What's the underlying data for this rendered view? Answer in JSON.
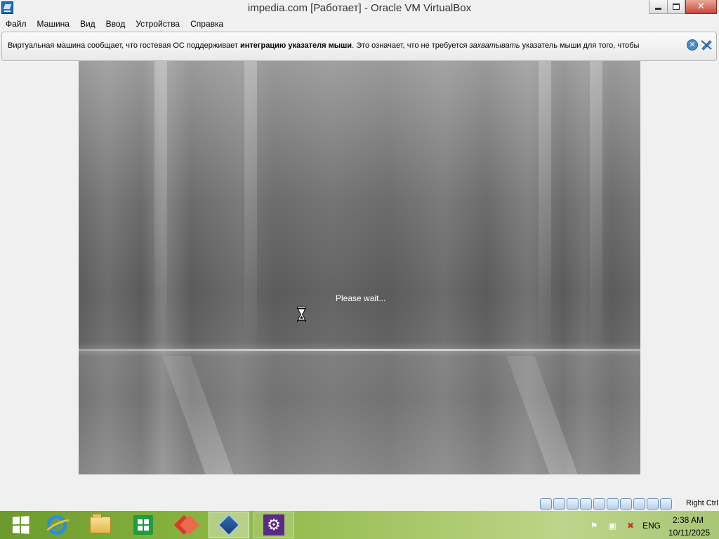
{
  "window": {
    "title": "impedia.com [Работает] - Oracle VM VirtualBox",
    "min_symbol": "",
    "close_symbol": "✕"
  },
  "menu": {
    "items": [
      {
        "label": "Файл"
      },
      {
        "label": "Машина"
      },
      {
        "label": "Вид"
      },
      {
        "label": "Ввод"
      },
      {
        "label": "Устройства"
      },
      {
        "label": "Справка"
      }
    ]
  },
  "notification": {
    "text_part1": "Виртуальная машина сообщает, что гостевая ОС поддерживает ",
    "text_bold": "интеграцию указателя мыши",
    "text_part2": ". Это означает, что не требуется ",
    "text_italic": "захватывать",
    "text_part3": " указатель мыши для того, чтобы",
    "close_symbol": "✕"
  },
  "guest": {
    "status_text": "Please wait..."
  },
  "statusbar": {
    "icons": [
      "hard-disk-icon",
      "optical-drive-icon",
      "audio-icon",
      "network-icon",
      "usb-icon",
      "shared-folders-icon",
      "display-icon",
      "video-capture-icon",
      "mouse-integration-icon",
      "virtualization-icon",
      "host-key-icon"
    ],
    "host_key": "Right Ctrl"
  },
  "taskbar": {
    "apps": [
      {
        "name": "start-button",
        "state": "normal"
      },
      {
        "name": "internet-explorer",
        "state": "normal"
      },
      {
        "name": "file-explorer",
        "state": "normal"
      },
      {
        "name": "windows-store",
        "state": "normal"
      },
      {
        "name": "gns3",
        "state": "normal"
      },
      {
        "name": "virtualbox",
        "state": "active"
      },
      {
        "name": "settings",
        "state": "open"
      }
    ],
    "ie_glyph": "e",
    "gear_glyph": "⚙",
    "tray": {
      "flag_glyph": "⚑",
      "network_glyph": "▣",
      "volume_glyph": "✖"
    },
    "language": "ENG",
    "time": "2:38 AM",
    "date": "10/11/2025"
  },
  "colors": {
    "taskbar_green": "#8bb541",
    "close_red": "#c7463a",
    "vbox_blue": "#1f6fb6"
  }
}
